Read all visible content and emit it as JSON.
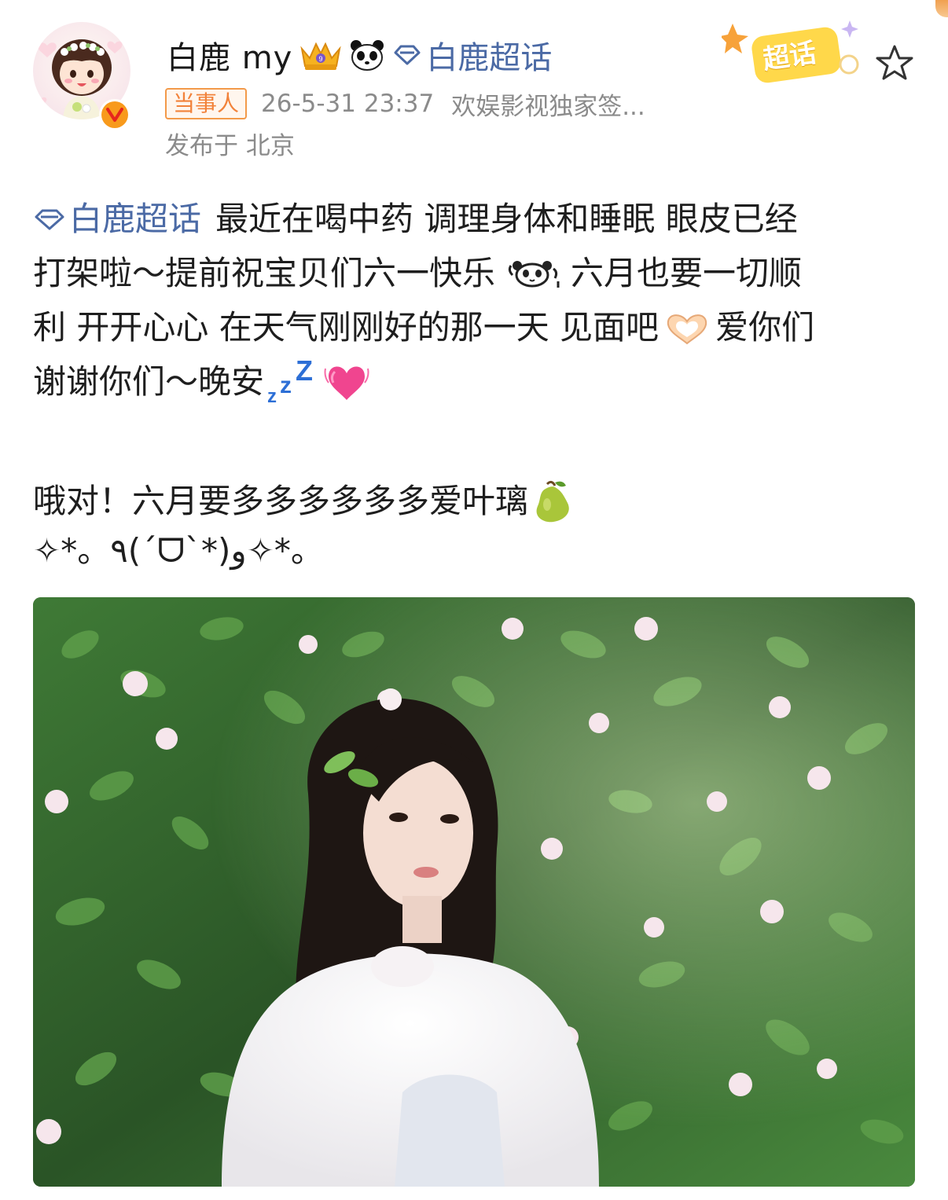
{
  "header": {
    "user_name": "白鹿 my",
    "topic_label": "白鹿超话",
    "supertopic_badge_label": "超话",
    "role_badge": "当事人",
    "post_time": "26-5-31 23:37",
    "post_source": "欢娱影视独家签...",
    "location": "发布于 北京",
    "icons": [
      "crown-icon",
      "panda-icon",
      "diamond-icon",
      "star-icon",
      "verified-v-icon"
    ]
  },
  "post": {
    "topic_link": "白鹿超话",
    "line1_rest": "最近在喝中药 调理身体和睡眠 眼皮已经",
    "line2_a": "打架啦～提前祝宝贝们六一快乐",
    "line2_b": "六月也要一切顺",
    "line3_a": "利 开开心心 在天气刚刚好的那一天 见面吧",
    "line3_b": "爱你们",
    "line4": "谢谢你们～晚安",
    "line5": "哦对！六月要多多多多多多爱叶璃",
    "line6": "✧*。٩(ˊᗜˋ*)و✧*。",
    "emojis": [
      "panda-emoji",
      "heart-hands-emoji",
      "zzz-emoji",
      "growing-heart-emoji",
      "pear-emoji"
    ]
  },
  "photo": {
    "description_icon": "photo-image"
  },
  "colors": {
    "link_blue": "#4b6aa5",
    "role_orange": "#f2823a",
    "meta_gray": "#8b8b8b",
    "text_dark": "#1e1e1e"
  }
}
